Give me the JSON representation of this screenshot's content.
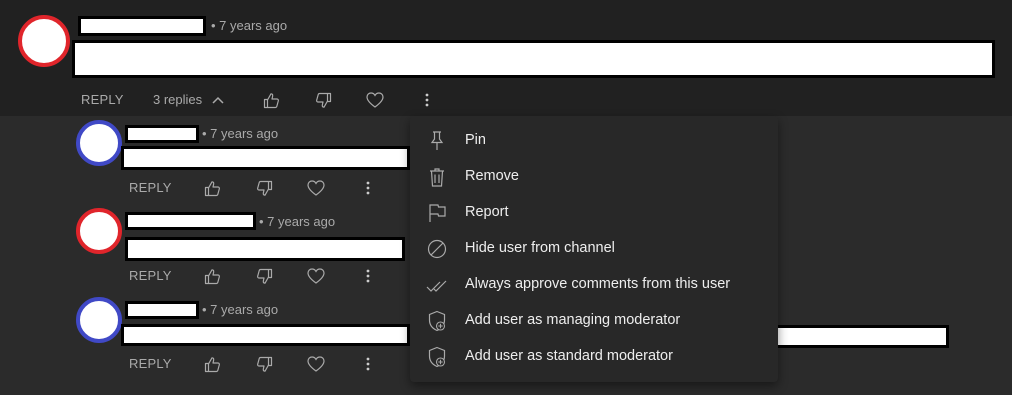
{
  "top_comment": {
    "timestamp": "• 7 years ago",
    "reply_label": "REPLY",
    "replies_label": "3 replies"
  },
  "replies": [
    {
      "timestamp": "• 7 years ago",
      "reply_label": "REPLY",
      "avatar_color": "#4049c6"
    },
    {
      "timestamp": "• 7 years ago",
      "reply_label": "REPLY",
      "avatar_color": "#e0252b"
    },
    {
      "timestamp": "• 7 years ago",
      "reply_label": "REPLY",
      "avatar_color": "#4049c6"
    }
  ],
  "menu": {
    "items": [
      {
        "label": "Pin",
        "icon": "pin-icon"
      },
      {
        "label": "Remove",
        "icon": "trash-icon"
      },
      {
        "label": "Report",
        "icon": "flag-icon"
      },
      {
        "label": "Hide user from channel",
        "icon": "block-icon"
      },
      {
        "label": "Always approve comments from this user",
        "icon": "double-check-icon"
      },
      {
        "label": "Add user as managing moderator",
        "icon": "shield-add-icon"
      },
      {
        "label": "Add user as standard moderator",
        "icon": "shield-add-icon"
      }
    ]
  },
  "colors": {
    "background": "#2b2b2b",
    "top_band": "#212121",
    "menu_bg": "#282828",
    "text_secondary": "#aaaaaa",
    "avatar_red": "#e0252b",
    "avatar_blue": "#4049c6"
  }
}
